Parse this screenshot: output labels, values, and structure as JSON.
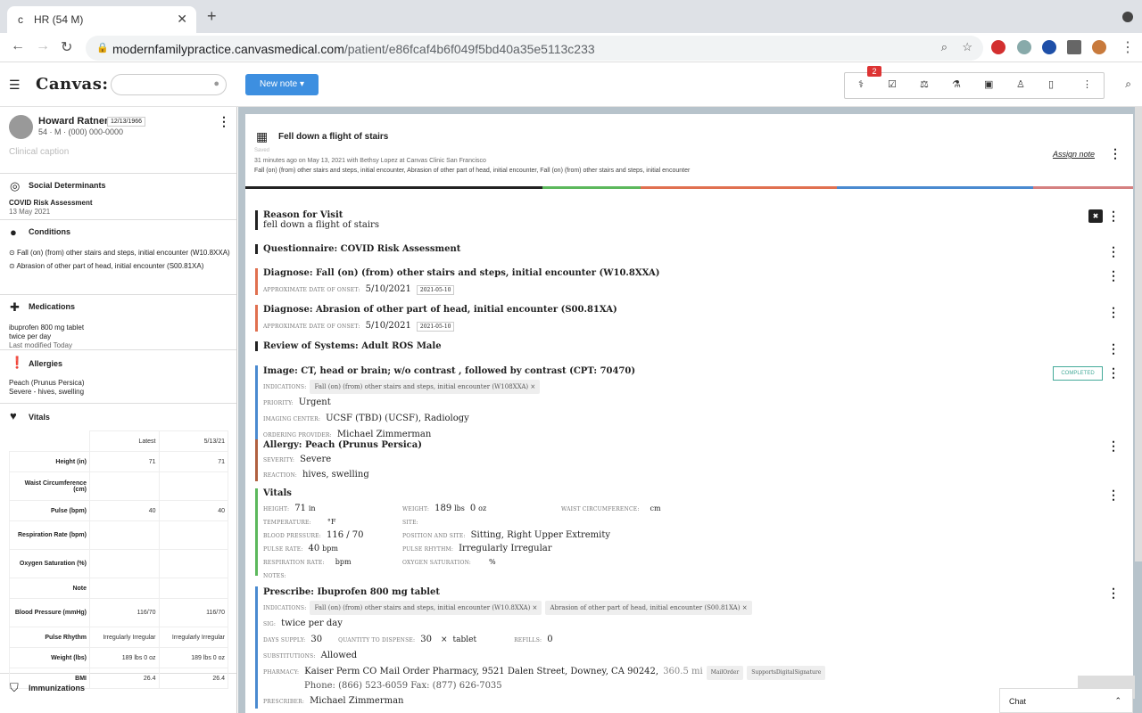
{
  "browser": {
    "tab_title": "HR (54 M)",
    "url_host": "modernfamilypractice.canvasmedical.com",
    "url_path": "/patient/e86fcaf4b6f049f5bd40a35e5113c233"
  },
  "app": {
    "logo": "Canvas:",
    "new_note": "New note",
    "badge": "2"
  },
  "patient": {
    "name": "Howard Ratner",
    "dob": "12/13/1966",
    "info": "54 · M · (000) 000-0000",
    "caption": "Clinical caption"
  },
  "sidebar": {
    "sdoh": {
      "title": "Social Determinants",
      "item": "COVID Risk Assessment",
      "date": "13 May 2021"
    },
    "conditions": {
      "title": "Conditions",
      "items": [
        "Fall (on) (from) other stairs and steps, initial encounter (W10.8XXA)",
        "Abrasion of other part of head, initial encounter (S00.81XA)"
      ]
    },
    "medications": {
      "title": "Medications",
      "name": "ibuprofen 800 mg tablet",
      "sig": "twice per day",
      "modified": "Last modified Today"
    },
    "allergies": {
      "title": "Allergies",
      "name": "Peach (Prunus Persica)",
      "detail": "Severe - hives, swelling"
    },
    "vitals": {
      "title": "Vitals",
      "col1": "Latest",
      "col2": "5/13/21",
      "rows": [
        [
          "Height (in)",
          "71",
          "71"
        ],
        [
          "Waist Circumference (cm)",
          "",
          ""
        ],
        [
          "Pulse (bpm)",
          "40",
          "40"
        ],
        [
          "Respiration Rate (bpm)",
          "",
          ""
        ],
        [
          "Oxygen Saturation (%)",
          "",
          ""
        ],
        [
          "Note",
          "",
          ""
        ],
        [
          "Blood Pressure (mmHg)",
          "116/70",
          "116/70"
        ],
        [
          "Pulse Rhythm",
          "Irregularly Irregular",
          "Irregularly Irregular"
        ],
        [
          "Weight (lbs)",
          "189 lbs 0 oz",
          "189 lbs 0 oz"
        ],
        [
          "BMI",
          "26.4",
          "26.4"
        ]
      ]
    },
    "immunizations": {
      "title": "Immunizations"
    }
  },
  "note": {
    "title": "Fell down a flight of stairs",
    "saved": "Saved",
    "meta1": "31 minutes ago on May 13, 2021 with Bethsy Lopez at Canvas Clinic San Francisco",
    "meta2": "Fall (on) (from) other stairs and steps, initial encounter, Abrasion of other part of head, initial encounter, Fall (on) (from) other stairs and steps, initial encounter",
    "assign": "Assign note"
  },
  "cmds": {
    "rfv": {
      "title": "Reason for Visit",
      "text": "fell down a flight of stairs"
    },
    "q": {
      "title": "Questionnaire: COVID Risk Assessment"
    },
    "d1": {
      "title": "Diagnose: Fall (on) (from) other stairs and steps, initial encounter  (W10.8XXA)",
      "lab": "APPROXIMATE DATE OF ONSET:",
      "val": "5/10/2021",
      "date": "2021-05-10"
    },
    "d2": {
      "title": "Diagnose: Abrasion of other part of head, initial encounter  (S00.81XA)",
      "lab": "APPROXIMATE DATE OF ONSET:",
      "val": "5/10/2021",
      "date": "2021-05-10"
    },
    "ros": {
      "title": "Review of Systems: Adult ROS Male"
    },
    "img": {
      "title": "Image: CT, head or brain; w/o contrast , followed by contrast (CPT: 70470)",
      "ind_lab": "INDICATIONS:",
      "ind": "Fall (on) (from) other stairs and steps, initial encounter (W108XXA) ×",
      "pri_lab": "PRIORITY:",
      "pri": "Urgent",
      "ctr_lab": "IMAGING CENTER:",
      "ctr": "UCSF (TBD) (UCSF), Radiology",
      "prov_lab": "ORDERING PROVIDER:",
      "prov": "Michael Zimmerman",
      "status": "COMPLETED"
    },
    "alg": {
      "title": "Allergy: Peach (Prunus Persica)",
      "sev_lab": "SEVERITY:",
      "sev": "Severe",
      "rea_lab": "REACTION:",
      "rea": "hives, swelling"
    },
    "vit": {
      "title": "Vitals",
      "h_lab": "HEIGHT:",
      "h": "71",
      "h_u": "in",
      "w_lab": "WEIGHT:",
      "w": "189",
      "w_u": "lbs",
      "w2": "0",
      "w2_u": "oz",
      "wc_lab": "WAIST CIRCUMFERENCE:",
      "wc_u": "cm",
      "t_lab": "TEMPERATURE:",
      "t_u": "°F",
      "site_lab": "SITE:",
      "bp_lab": "BLOOD PRESSURE:",
      "bp": "116 / 70",
      "pos_lab": "POSITION AND SITE:",
      "pos": "Sitting, Right Upper Extremity",
      "pr_lab": "PULSE RATE:",
      "pr": "40",
      "pr_u": "bpm",
      "rh_lab": "PULSE RHYTHM:",
      "rh": "Irregularly Irregular",
      "rr_lab": "RESPIRATION RATE:",
      "rr_u": "bpm",
      "ox_lab": "OXYGEN SATURATION:",
      "ox_u": "%",
      "notes_lab": "NOTES:"
    },
    "rx": {
      "title": "Prescribe: Ibuprofen 800 mg tablet",
      "ind_lab": "INDICATIONS:",
      "ind1": "Fall (on) (from) other stairs and steps, initial encounter  (W10.8XXA) ×",
      "ind2": "Abrasion of other part of head, initial encounter  (S00.81XA) ×",
      "sig_lab": "SIG:",
      "sig": "twice per day",
      "ds_lab": "DAYS SUPPLY:",
      "ds": "30",
      "qty_lab": "QUANTITY TO DISPENSE:",
      "qty": "30",
      "qty_u": "tablet",
      "ref_lab": "REFILLS:",
      "ref": "0",
      "sub_lab": "SUBSTITUTIONS:",
      "sub": "Allowed",
      "ph_lab": "PHARMACY:",
      "ph": "Kaiser Perm CO Mail Order Pharmacy, 9521 Dalen Street, Downey, CA 90242,",
      "ph_dist": "360.5 mi",
      "ph_c1": "MailOrder",
      "ph_c2": "SupportsDigitalSignature",
      "ph_phone": "Phone: (866) 523-6059 Fax: (877) 626-7035",
      "pre_lab": "PRESCRIBER:",
      "pre": "Michael Zimmerman"
    }
  },
  "chat": "Chat"
}
